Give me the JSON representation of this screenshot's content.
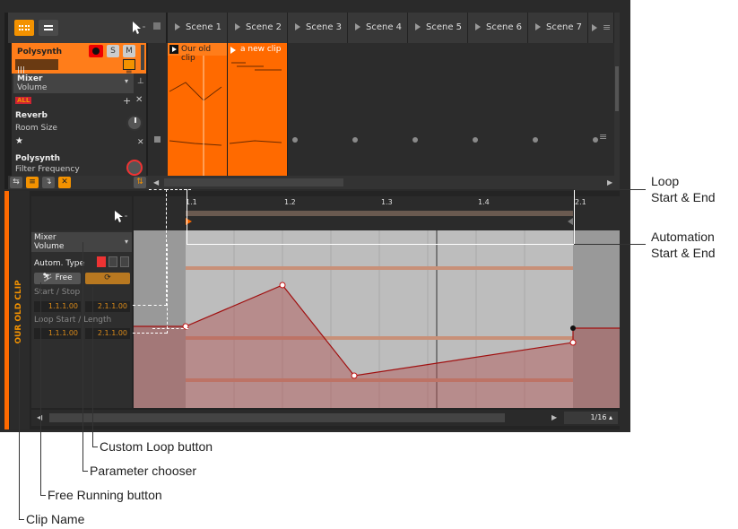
{
  "toolbar": {
    "pointer_icon": "pointer-icon"
  },
  "scenes": [
    "Scene 1",
    "Scene 2",
    "Scene 3",
    "Scene 4",
    "Scene 5",
    "Scene 6",
    "Scene 7"
  ],
  "track": {
    "name": "Polysynth",
    "solo": "S",
    "mute": "M"
  },
  "clips": {
    "clip1": "Our old clip",
    "clip2": "a new clip"
  },
  "device_panel": {
    "mixer_title": "Mixer",
    "mixer_param": "Volume",
    "all_badge": "ALL",
    "reverb_title": "Reverb",
    "reverb_param": "Room Size",
    "poly_title": "Polysynth",
    "poly_param": "Filter Frequency"
  },
  "clip_editor": {
    "clip_name": "OUR OLD CLIP",
    "param_title": "Mixer",
    "param_sub": "Volume",
    "autom_type": "Autom. Type",
    "free_label": "Free",
    "start_stop": "Start / Stop",
    "start_val": "1.1.1.00",
    "stop_val": "2.1.1.00",
    "loop_label": "Loop Start / Length",
    "loop_start_val": "1.1.1.00",
    "loop_len_val": "2.1.1.00",
    "grid": "1/16"
  },
  "ruler": [
    "1.1",
    "1.2",
    "1.3",
    "1.4",
    "2.1"
  ],
  "callouts": {
    "loop": "Loop\nStart & End",
    "loop_1": "Loop",
    "loop_2": "Start & End",
    "auto_1": "Automation",
    "auto_2": "Start & End",
    "custom_loop": "Custom Loop button",
    "param_chooser": "Parameter chooser",
    "free_running": "Free Running button",
    "clip_name": "Clip Name"
  },
  "colors": {
    "accent": "#ff6a00",
    "envelope": "#b01818",
    "loop_bar": "#c87850"
  }
}
